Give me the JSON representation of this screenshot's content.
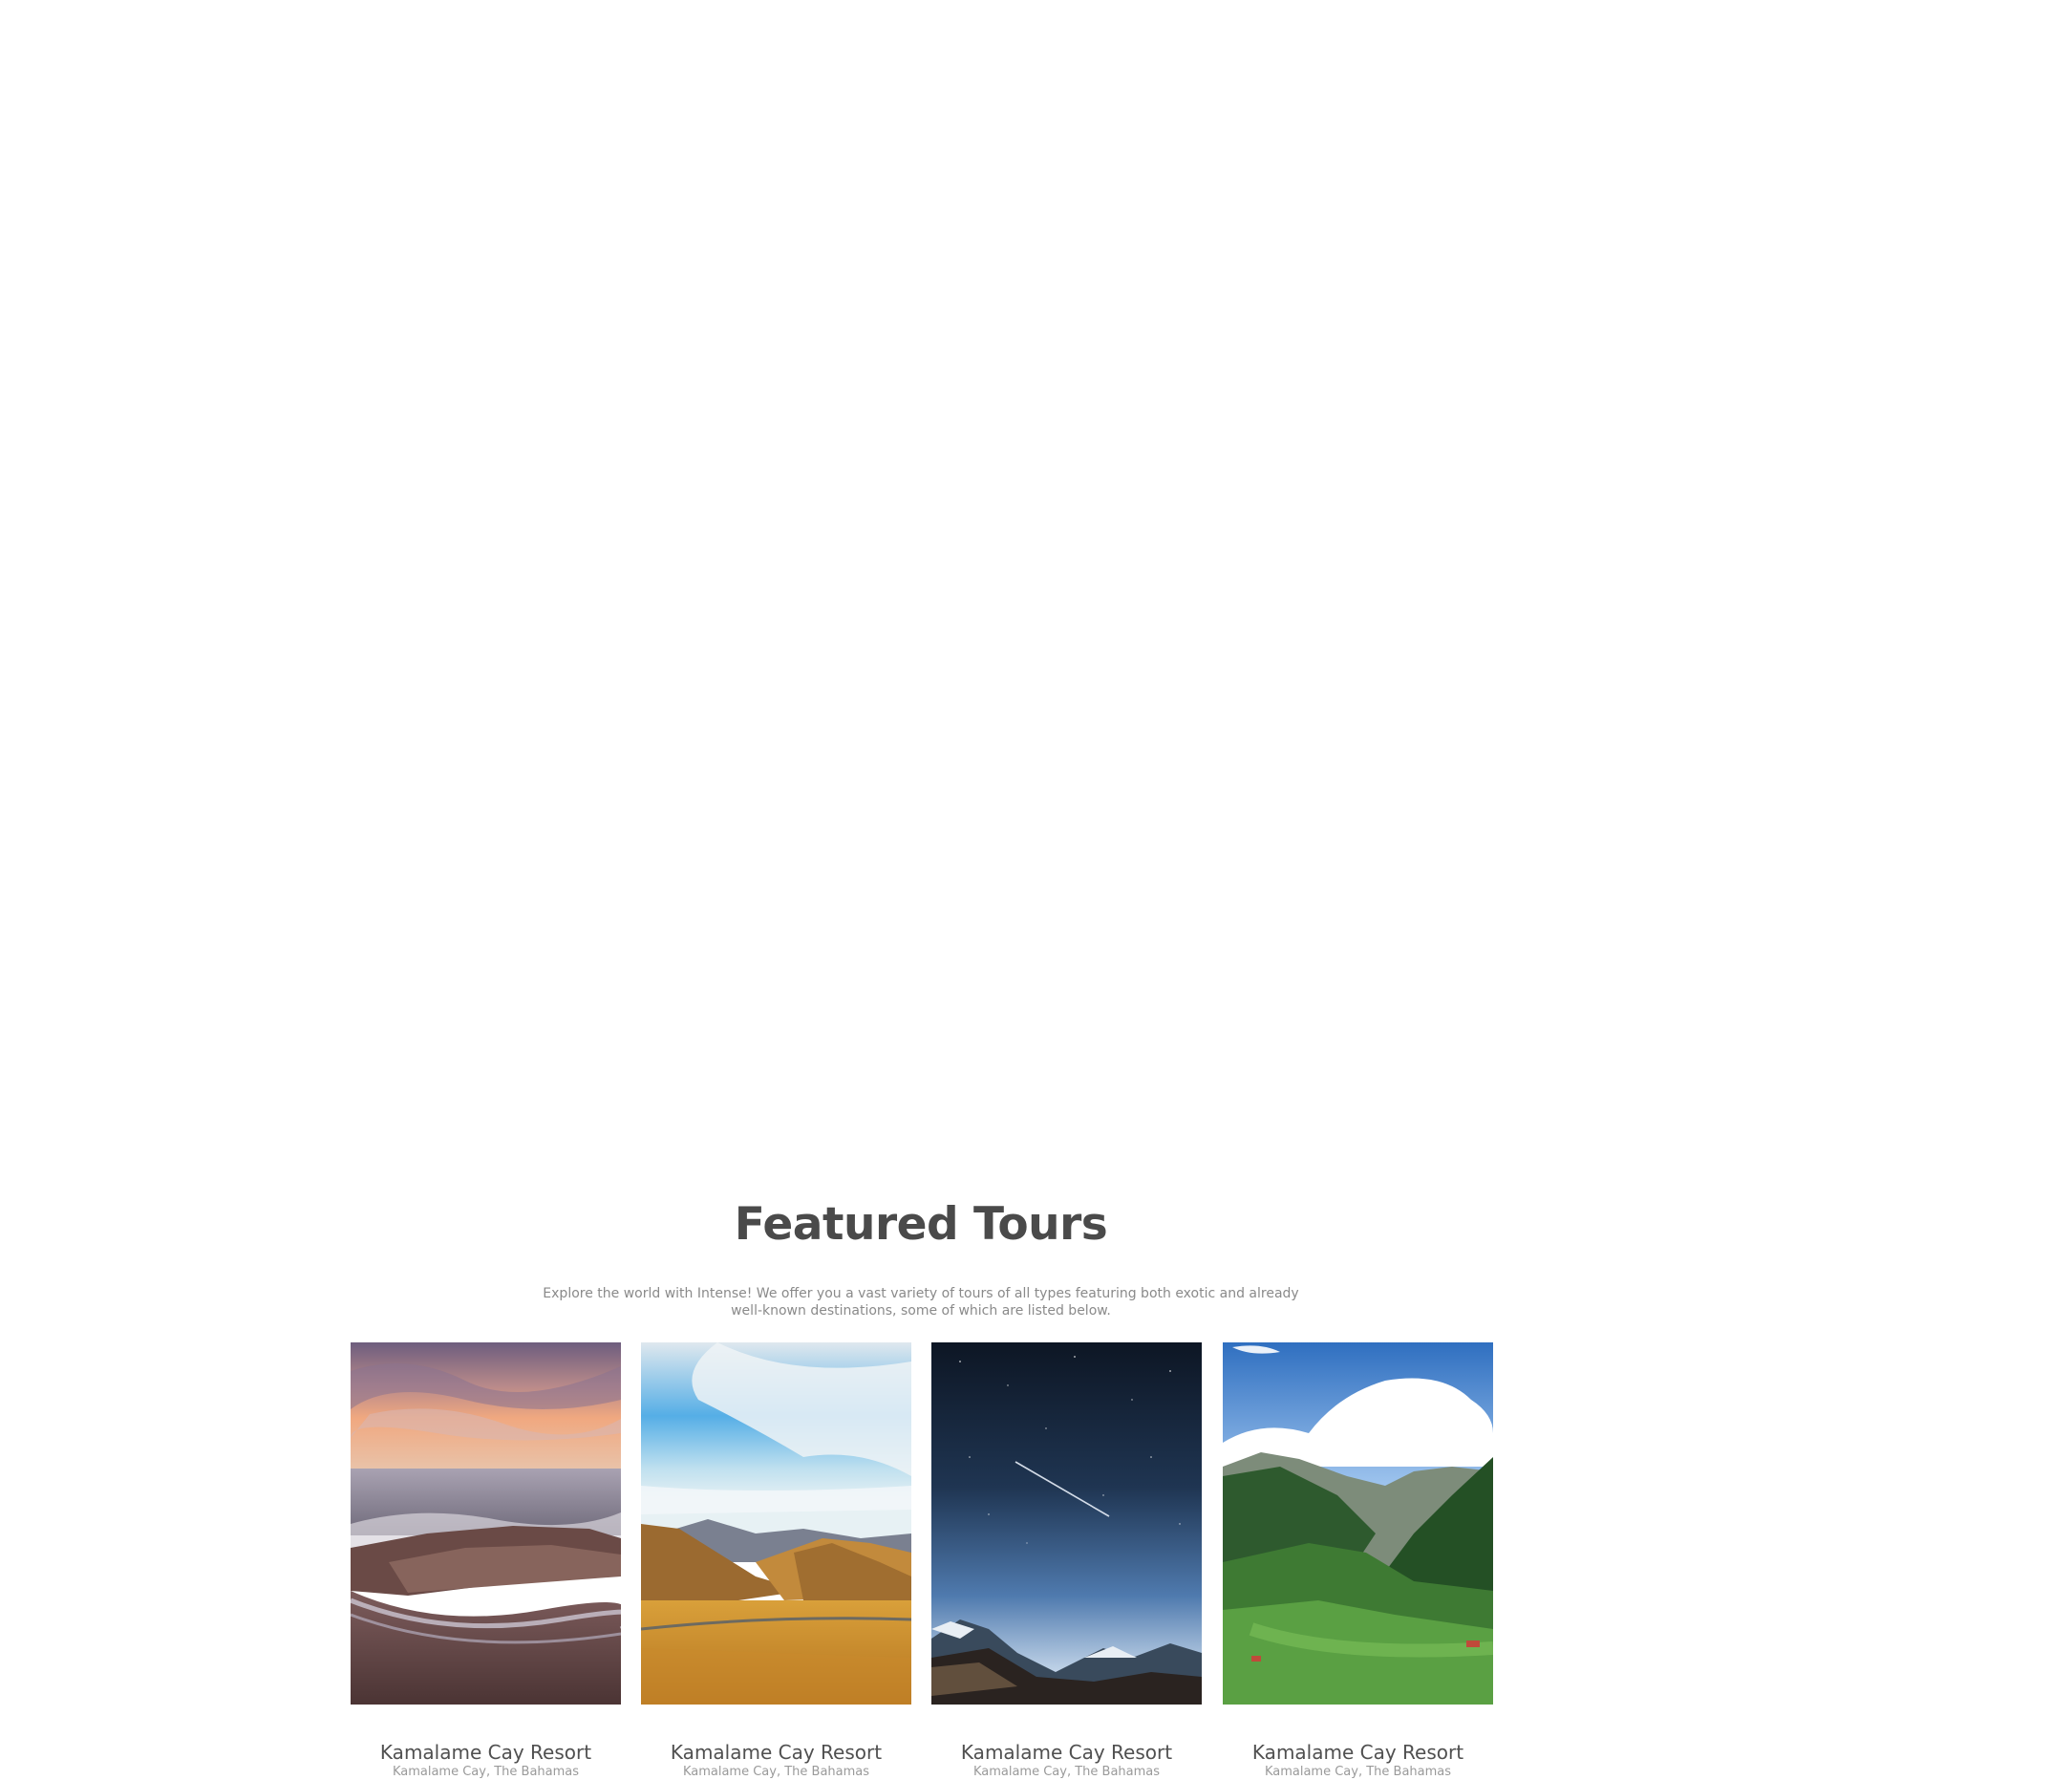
{
  "section": {
    "title": "Featured Tours",
    "intro": "Explore the world with Intense! We offer you a vast variety of tours of all types featuring both exotic and already well-known destinations, some of which are listed below."
  },
  "tours": [
    {
      "title": "Kamalame Cay Resort",
      "location": "Kamalame Cay, The Bahamas",
      "image": "sunset-beach-photo"
    },
    {
      "title": "Kamalame Cay Resort",
      "location": "Kamalame Cay, The Bahamas",
      "image": "golden-valley-photo"
    },
    {
      "title": "Kamalame Cay Resort",
      "location": "Kamalame Cay, The Bahamas",
      "image": "night-sky-mountains-photo"
    },
    {
      "title": "Kamalame Cay Resort",
      "location": "Kamalame Cay, The Bahamas",
      "image": "green-alpine-valley-photo"
    }
  ]
}
